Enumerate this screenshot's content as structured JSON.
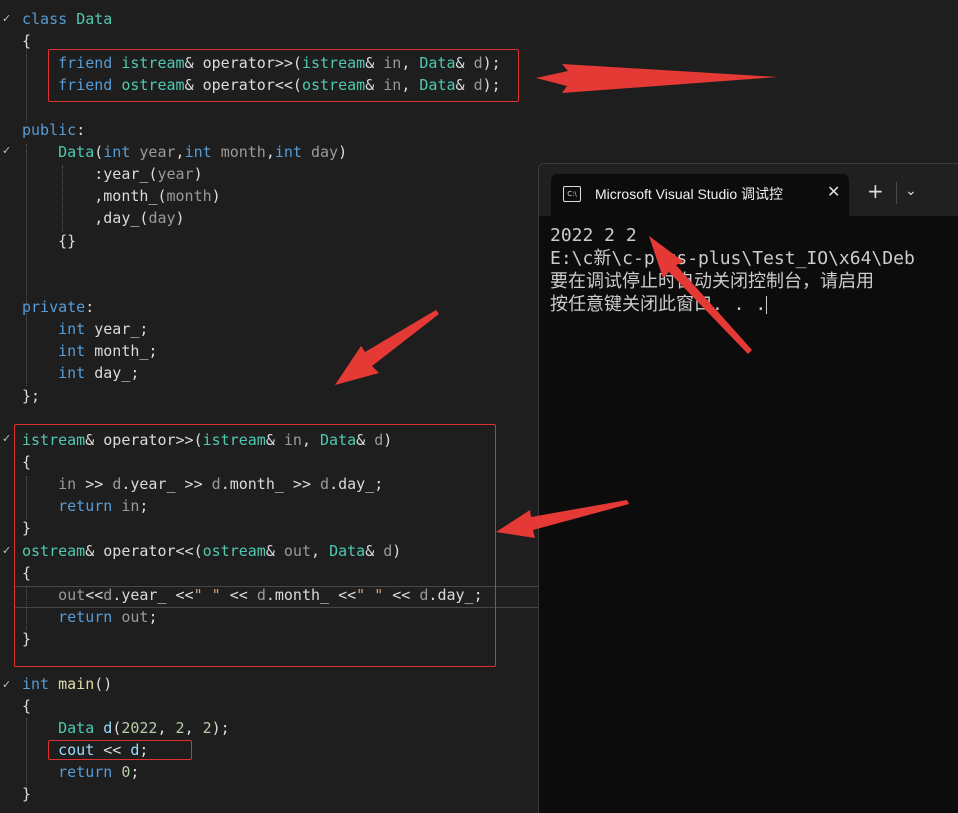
{
  "editor": {
    "lines": [
      [
        [
          "kw",
          "class "
        ],
        [
          "ty",
          "Data"
        ]
      ],
      [
        [
          "pl",
          "{"
        ]
      ],
      [
        [
          "pl",
          "    "
        ],
        [
          "kw",
          "friend "
        ],
        [
          "ty",
          "istream"
        ],
        [
          "pl",
          "& operator>>("
        ],
        [
          "ty",
          "istream"
        ],
        [
          "pl",
          "& "
        ],
        [
          "pa",
          "in"
        ],
        [
          "pl",
          ", "
        ],
        [
          "ty",
          "Data"
        ],
        [
          "pl",
          "& "
        ],
        [
          "pa",
          "d"
        ],
        [
          "pl",
          ");"
        ]
      ],
      [
        [
          "pl",
          "    "
        ],
        [
          "kw",
          "friend "
        ],
        [
          "ty",
          "ostream"
        ],
        [
          "pl",
          "& operator<<("
        ],
        [
          "ty",
          "ostream"
        ],
        [
          "pl",
          "& "
        ],
        [
          "pa",
          "in"
        ],
        [
          "pl",
          ", "
        ],
        [
          "ty",
          "Data"
        ],
        [
          "pl",
          "& "
        ],
        [
          "pa",
          "d"
        ],
        [
          "pl",
          ");"
        ]
      ],
      [],
      [
        [
          "kw",
          "public"
        ],
        [
          "pl",
          ":"
        ]
      ],
      [
        [
          "pl",
          "    "
        ],
        [
          "ty",
          "Data"
        ],
        [
          "pl",
          "("
        ],
        [
          "kw",
          "int "
        ],
        [
          "pa",
          "year"
        ],
        [
          "pl",
          ","
        ],
        [
          "kw",
          "int "
        ],
        [
          "pa",
          "month"
        ],
        [
          "pl",
          ","
        ],
        [
          "kw",
          "int "
        ],
        [
          "pa",
          "day"
        ],
        [
          "pl",
          ")"
        ]
      ],
      [
        [
          "pl",
          "        :"
        ],
        [
          "mb",
          "year_"
        ],
        [
          "pl",
          "("
        ],
        [
          "pa",
          "year"
        ],
        [
          "pl",
          ")"
        ]
      ],
      [
        [
          "pl",
          "        ,"
        ],
        [
          "mb",
          "month_"
        ],
        [
          "pl",
          "("
        ],
        [
          "pa",
          "month"
        ],
        [
          "pl",
          ")"
        ]
      ],
      [
        [
          "pl",
          "        ,"
        ],
        [
          "mb",
          "day_"
        ],
        [
          "pl",
          "("
        ],
        [
          "pa",
          "day"
        ],
        [
          "pl",
          ")"
        ]
      ],
      [
        [
          "pl",
          "    {}"
        ]
      ],
      [],
      [],
      [
        [
          "kw",
          "private"
        ],
        [
          "pl",
          ":"
        ]
      ],
      [
        [
          "pl",
          "    "
        ],
        [
          "kw",
          "int "
        ],
        [
          "mb",
          "year_"
        ],
        [
          "pl",
          ";"
        ]
      ],
      [
        [
          "pl",
          "    "
        ],
        [
          "kw",
          "int "
        ],
        [
          "mb",
          "month_"
        ],
        [
          "pl",
          ";"
        ]
      ],
      [
        [
          "pl",
          "    "
        ],
        [
          "kw",
          "int "
        ],
        [
          "mb",
          "day_"
        ],
        [
          "pl",
          ";"
        ]
      ],
      [
        [
          "pl",
          "};"
        ]
      ],
      [],
      [
        [
          "ty",
          "istream"
        ],
        [
          "pl",
          "& operator>>("
        ],
        [
          "ty",
          "istream"
        ],
        [
          "pl",
          "& "
        ],
        [
          "pa",
          "in"
        ],
        [
          "pl",
          ", "
        ],
        [
          "ty",
          "Data"
        ],
        [
          "pl",
          "& "
        ],
        [
          "pa",
          "d"
        ],
        [
          "pl",
          ")"
        ]
      ],
      [
        [
          "pl",
          "{"
        ]
      ],
      [
        [
          "pl",
          "    "
        ],
        [
          "pa",
          "in"
        ],
        [
          "pl",
          " >> "
        ],
        [
          "pa",
          "d"
        ],
        [
          "pl",
          "."
        ],
        [
          "mb",
          "year_"
        ],
        [
          "pl",
          " >> "
        ],
        [
          "pa",
          "d"
        ],
        [
          "pl",
          "."
        ],
        [
          "mb",
          "month_"
        ],
        [
          "pl",
          " >> "
        ],
        [
          "pa",
          "d"
        ],
        [
          "pl",
          "."
        ],
        [
          "mb",
          "day_"
        ],
        [
          "pl",
          ";"
        ]
      ],
      [
        [
          "pl",
          "    "
        ],
        [
          "kw",
          "return "
        ],
        [
          "pa",
          "in"
        ],
        [
          "pl",
          ";"
        ]
      ],
      [
        [
          "pl",
          "}"
        ]
      ],
      [
        [
          "ty",
          "ostream"
        ],
        [
          "pl",
          "& operator<<("
        ],
        [
          "ty",
          "ostream"
        ],
        [
          "pl",
          "& "
        ],
        [
          "pa",
          "out"
        ],
        [
          "pl",
          ", "
        ],
        [
          "ty",
          "Data"
        ],
        [
          "pl",
          "& "
        ],
        [
          "pa",
          "d"
        ],
        [
          "pl",
          ")"
        ]
      ],
      [
        [
          "pl",
          "{"
        ]
      ],
      [
        [
          "pl",
          "    "
        ],
        [
          "pa",
          "out"
        ],
        [
          "pl",
          "<<"
        ],
        [
          "pa",
          "d"
        ],
        [
          "pl",
          "."
        ],
        [
          "mb",
          "year_"
        ],
        [
          "pl",
          " <<"
        ],
        [
          "st",
          "\" \""
        ],
        [
          "pl",
          " << "
        ],
        [
          "pa",
          "d"
        ],
        [
          "pl",
          "."
        ],
        [
          "mb",
          "month_"
        ],
        [
          "pl",
          " <<"
        ],
        [
          "st",
          "\" \""
        ],
        [
          "pl",
          " << "
        ],
        [
          "pa",
          "d"
        ],
        [
          "pl",
          "."
        ],
        [
          "mb",
          "day_"
        ],
        [
          "pl",
          ";"
        ]
      ],
      [
        [
          "pl",
          "    "
        ],
        [
          "kw",
          "return "
        ],
        [
          "pa",
          "out"
        ],
        [
          "pl",
          ";"
        ]
      ],
      [
        [
          "pl",
          "}"
        ]
      ],
      [],
      [
        [
          "kw",
          "int "
        ],
        [
          "fn",
          "main"
        ],
        [
          "pl",
          "()"
        ]
      ],
      [
        [
          "pl",
          "{"
        ]
      ],
      [
        [
          "pl",
          "    "
        ],
        [
          "ty",
          "Data "
        ],
        [
          "va",
          "d"
        ],
        [
          "pl",
          "("
        ],
        [
          "nu",
          "2022"
        ],
        [
          "pl",
          ", "
        ],
        [
          "nu",
          "2"
        ],
        [
          "pl",
          ", "
        ],
        [
          "nu",
          "2"
        ],
        [
          "pl",
          ");"
        ]
      ],
      [
        [
          "pl",
          "    "
        ],
        [
          "va",
          "cout"
        ],
        [
          "pl",
          " << "
        ],
        [
          "va",
          "d"
        ],
        [
          "pl",
          ";"
        ]
      ],
      [
        [
          "pl",
          "    "
        ],
        [
          "kw",
          "return "
        ],
        [
          "nu",
          "0"
        ],
        [
          "pl",
          ";"
        ]
      ],
      [
        [
          "pl",
          "}"
        ]
      ]
    ]
  },
  "console": {
    "tab_icon": "C:\\",
    "tab_title": "Microsoft Visual Studio 调试控",
    "close_glyph": "✕",
    "new_tab_glyph": "+",
    "dropdown_glyph": "⌄",
    "output": [
      "2022 2 2",
      "E:\\c新\\c-plus-plus\\Test_IO\\x64\\Deb",
      "要在调试停止时自动关闭控制台，请启用",
      "按任意键关闭此窗口. . ."
    ]
  },
  "colors": {
    "keyword": "#569cd6",
    "type": "#4ec9b0",
    "string": "#d69d85",
    "number": "#b5cea8",
    "annotation": "#e03131"
  }
}
